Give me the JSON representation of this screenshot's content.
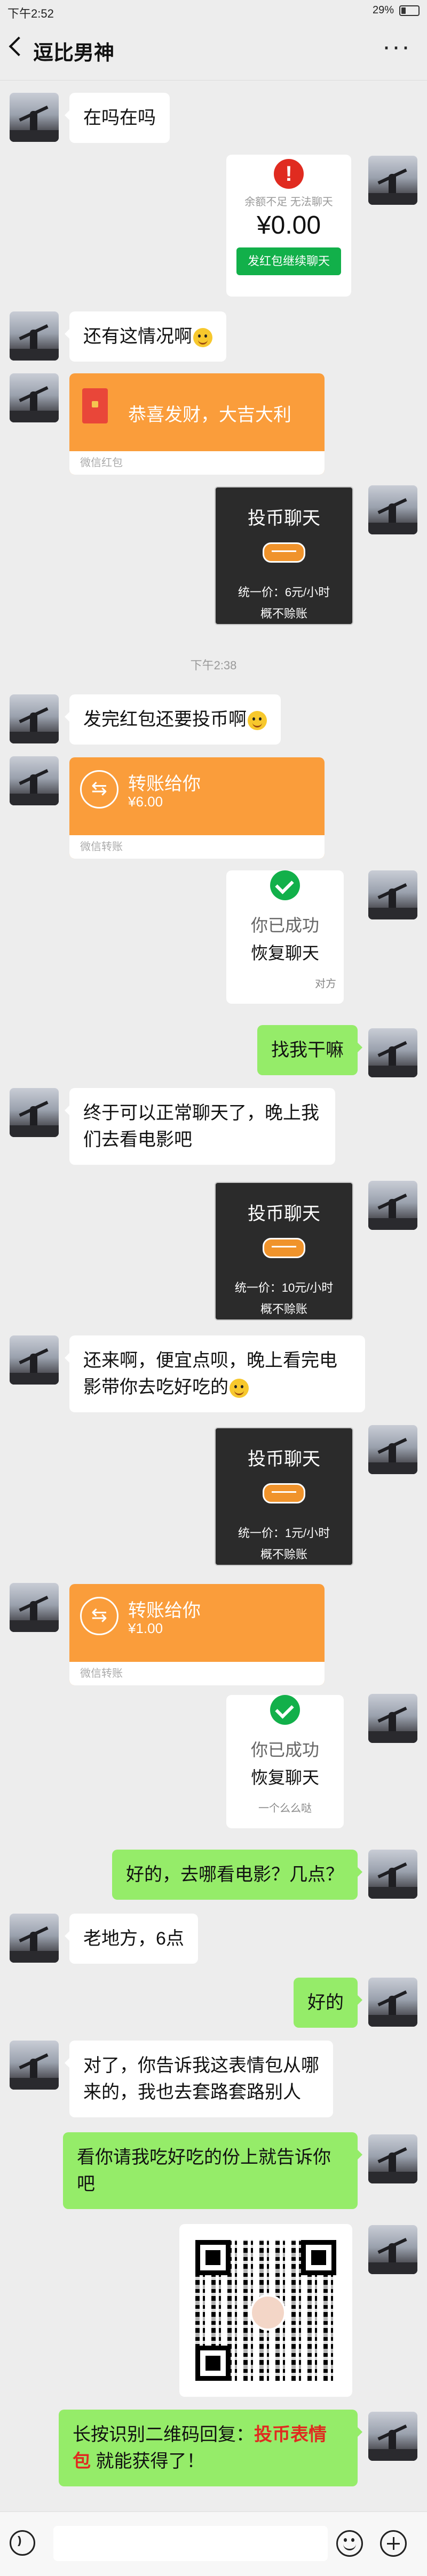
{
  "status_bar": {
    "time": "下午2:52",
    "battery": "29%"
  },
  "header": {
    "title": "逗比男神",
    "more": "···"
  },
  "messages": {
    "m1": "在吗在吗",
    "balance": {
      "notice": "余额不足 无法聊天",
      "amount": "¥0.00",
      "button": "发红包继续聊天"
    },
    "m3": "还有这情况啊",
    "red_packet": {
      "text": "恭喜发财，大吉大利",
      "footer": "微信红包"
    },
    "coin1": {
      "title": "投币聊天",
      "price": "统一价：6元/小时",
      "note": "概不赊账"
    },
    "time1": "下午2:38",
    "m6": "发完红包还要投币啊",
    "transfer1": {
      "title": "转账给你",
      "amount": "¥6.00",
      "footer": "微信转账"
    },
    "success1": {
      "line1": "你已成功",
      "line2": "恢复聊天",
      "sign": "对方"
    },
    "m9": "找我干嘛",
    "m10": "终于可以正常聊天了，晚上我们去看电影吧",
    "coin2": {
      "title": "投币聊天",
      "price": "统一价：10元/小时",
      "note": "概不赊账"
    },
    "m12": "还来啊，便宜点呗，晚上看完电影带你去吃好吃的",
    "coin3": {
      "title": "投币聊天",
      "price": "统一价：1元/小时",
      "note": "概不赊账"
    },
    "transfer2": {
      "title": "转账给你",
      "amount": "¥1.00",
      "footer": "微信转账"
    },
    "success2": {
      "line1": "你已成功",
      "line2": "恢复聊天",
      "sign": "一个么么哒"
    },
    "m16": "好的，去哪看电影？几点？",
    "m17": "老地方，6点",
    "m18": "好的",
    "m19": "对了，你告诉我这表情包从哪来的，我也去套路套路别人",
    "m20": "看你请我吃好吃的份上就告诉你吧",
    "m22_a": "长按识别二维码回复：",
    "m22_b": "投币表情包",
    "m22_c": "就能获得了！"
  },
  "input": {
    "placeholder": ""
  }
}
